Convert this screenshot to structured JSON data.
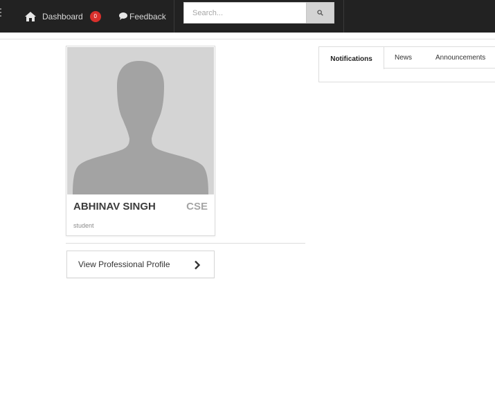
{
  "navbar": {
    "dashboard_label": "Dashboard",
    "dashboard_badge": "0",
    "feedback_label": "Feedback",
    "search_placeholder": "Search..."
  },
  "profile": {
    "name": "ABHINAV SINGH",
    "department": "CSE",
    "role": "student",
    "view_profile_label": "View Professional Profile"
  },
  "tabs": [
    {
      "label": "Notifications",
      "active": true
    },
    {
      "label": "News",
      "active": false
    },
    {
      "label": "Announcements",
      "active": false
    }
  ],
  "colors": {
    "navbar_bg": "#222222",
    "badge_bg": "#d9302c",
    "avatar_bg": "#d4d4d4",
    "silhouette": "#a3a3a3"
  },
  "icons": {
    "dashboard": "home-icon",
    "feedback": "comment-icon",
    "search": "search-icon",
    "profile_button": "chevron-right-icon"
  }
}
